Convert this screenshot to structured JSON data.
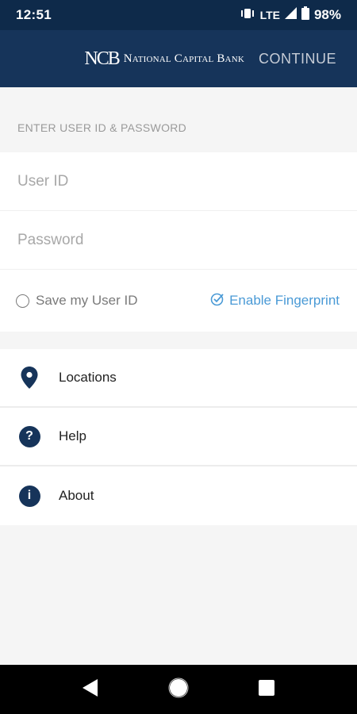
{
  "status_bar": {
    "time": "12:51",
    "network": "LTE",
    "battery": "98%"
  },
  "header": {
    "bank_monogram": "NCB",
    "bank_name": "National Capital Bank",
    "continue_label": "CONTINUE"
  },
  "login": {
    "section_label": "ENTER USER ID & PASSWORD",
    "user_id_placeholder": "User ID",
    "password_placeholder": "Password",
    "save_user_id_label": "Save my User ID",
    "enable_fingerprint_label": "Enable Fingerprint"
  },
  "menu": {
    "items": [
      {
        "label": "Locations",
        "icon": "location-pin-icon"
      },
      {
        "label": "Help",
        "icon": "question-icon"
      },
      {
        "label": "About",
        "icon": "info-icon"
      }
    ]
  },
  "colors": {
    "header": "#16345a",
    "status_bar": "#0e2a4a",
    "accent": "#4a9ad6",
    "icon": "#16345a"
  }
}
